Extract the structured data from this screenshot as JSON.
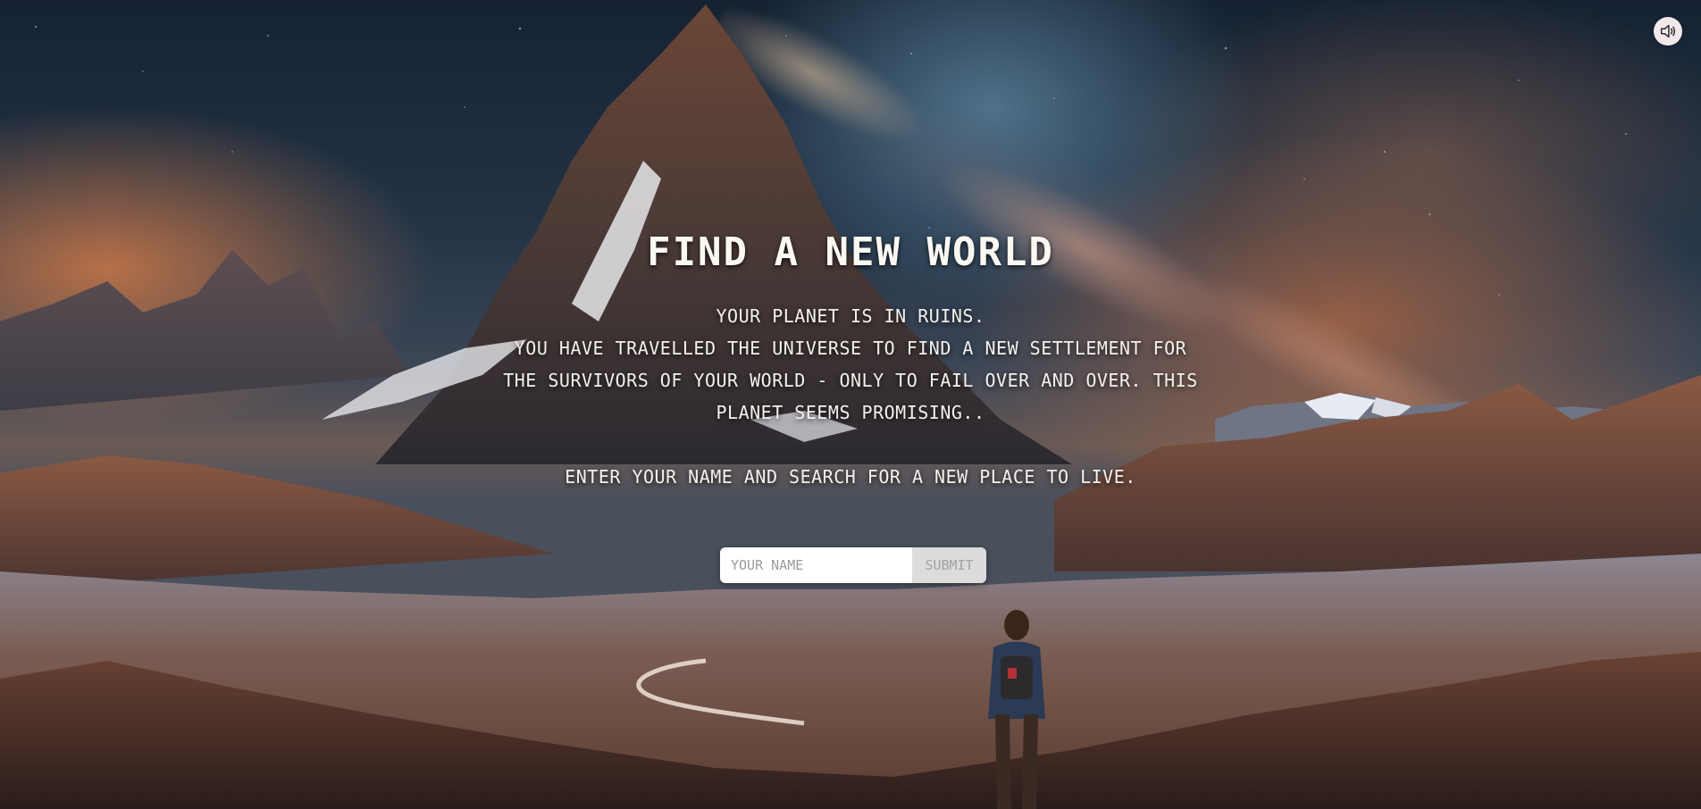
{
  "page": {
    "title": "FIND A NEW WORLD",
    "intro_line_1": "YOUR PLANET IS IN RUINS.",
    "intro_line_2": "YOU HAVE TRAVELLED THE UNIVERSE TO FIND A NEW SETTLEMENT FOR THE SURVIVORS OF YOUR WORLD - ONLY TO FAIL OVER AND OVER. THIS PLANET SEEMS PROMISING..",
    "prompt": "ENTER YOUR NAME AND SEARCH FOR A NEW PLACE TO LIVE."
  },
  "form": {
    "name_placeholder": "YOUR NAME",
    "name_value": "",
    "submit_label": "SUBMIT"
  },
  "controls": {
    "sound_icon": "speaker-icon"
  },
  "colors": {
    "text": "#fbf8f2",
    "input_bg": "#ffffff",
    "submit_bg": "#dcdcdc",
    "submit_text": "#a2a2a2",
    "sound_button_bg": "#f1e9e9"
  }
}
